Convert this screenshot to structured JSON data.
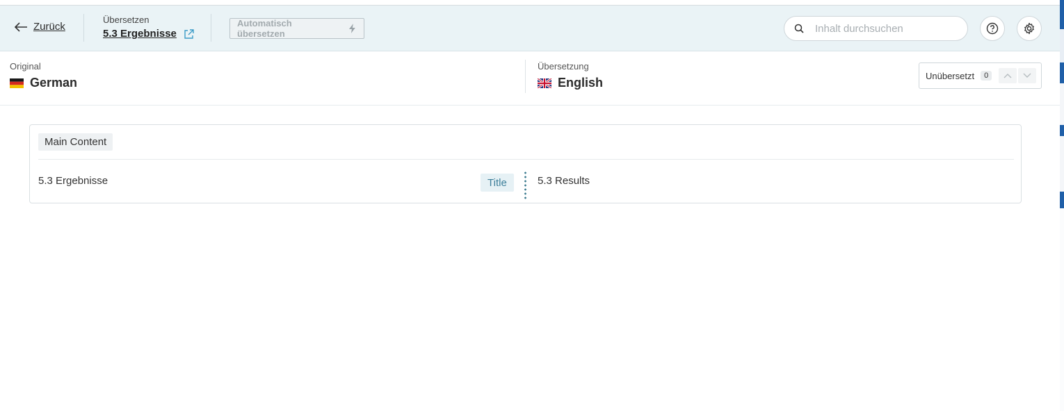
{
  "header": {
    "back_label": "Zurück",
    "crumb_caption": "Übersetzen",
    "crumb_title": "5.3 Ergebnisse",
    "auto_translate_label": "Automatisch übersetzen",
    "search_placeholder": "Inhalt durchsuchen",
    "icons": [
      "back-arrow-icon",
      "external-link-icon",
      "lightning-icon",
      "search-icon",
      "help-icon",
      "gear-icon"
    ]
  },
  "languages": {
    "original_caption": "Original",
    "original_lang": "German",
    "translation_caption": "Übersetzung",
    "translation_lang": "English",
    "filter_label": "Unübersetzt",
    "filter_count": "0"
  },
  "content": {
    "section_label": "Main Content",
    "rows": [
      {
        "original": "5.3 Ergebnisse",
        "field": "Title",
        "translation": "5.3 Results"
      }
    ]
  },
  "colors": {
    "header_bg": "#eaf3f6",
    "accent": "#3d7f9a",
    "link_icon": "#3b9bc7"
  }
}
